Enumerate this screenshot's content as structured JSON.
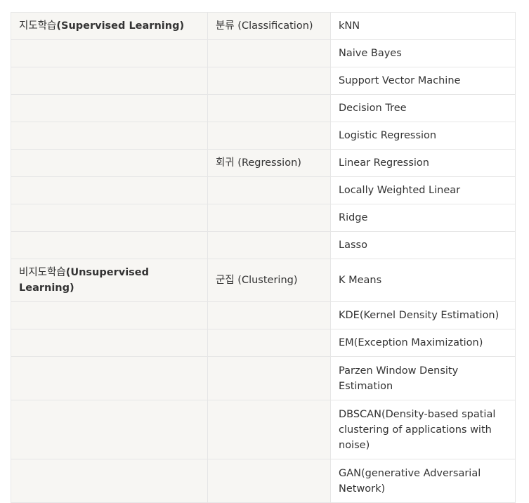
{
  "rows": [
    {
      "cat_ko": "지도학습",
      "cat_en": "(Supervised Learning)",
      "sub": "분류 (Classification)",
      "item": "kNN"
    },
    {
      "cat_ko": "",
      "cat_en": "",
      "sub": "",
      "item": "Naive Bayes"
    },
    {
      "cat_ko": "",
      "cat_en": "",
      "sub": "",
      "item": "Support Vector Machine"
    },
    {
      "cat_ko": "",
      "cat_en": "",
      "sub": "",
      "item": "Decision Tree"
    },
    {
      "cat_ko": "",
      "cat_en": "",
      "sub": "",
      "item": "Logistic Regression"
    },
    {
      "cat_ko": "",
      "cat_en": "",
      "sub": "회귀 (Regression)",
      "item": "Linear Regression"
    },
    {
      "cat_ko": "",
      "cat_en": "",
      "sub": "",
      "item": "Locally Weighted Linear"
    },
    {
      "cat_ko": "",
      "cat_en": "",
      "sub": "",
      "item": "Ridge"
    },
    {
      "cat_ko": "",
      "cat_en": "",
      "sub": "",
      "item": "Lasso"
    },
    {
      "cat_ko": "비지도학습",
      "cat_en": "(Unsupervised Learning)",
      "sub": "군집 (Clustering)",
      "item": "K Means"
    },
    {
      "cat_ko": "",
      "cat_en": "",
      "sub": "",
      "item": "KDE(Kernel Density Estimation)"
    },
    {
      "cat_ko": "",
      "cat_en": "",
      "sub": "",
      "item": "EM(Exception Maximization)"
    },
    {
      "cat_ko": "",
      "cat_en": "",
      "sub": "",
      "item": "Parzen Window Density Estimation"
    },
    {
      "cat_ko": "",
      "cat_en": "",
      "sub": "",
      "item": "DBSCAN(Density-based spatial clustering of applications with noise)"
    },
    {
      "cat_ko": "",
      "cat_en": "",
      "sub": "",
      "item": "GAN(generative Adversarial Network)"
    }
  ],
  "colors": {
    "label_column_bg": "#f7f6f3",
    "item_column_bg": "#ffffff",
    "border": "#e6e6e6",
    "text": "#333333"
  }
}
